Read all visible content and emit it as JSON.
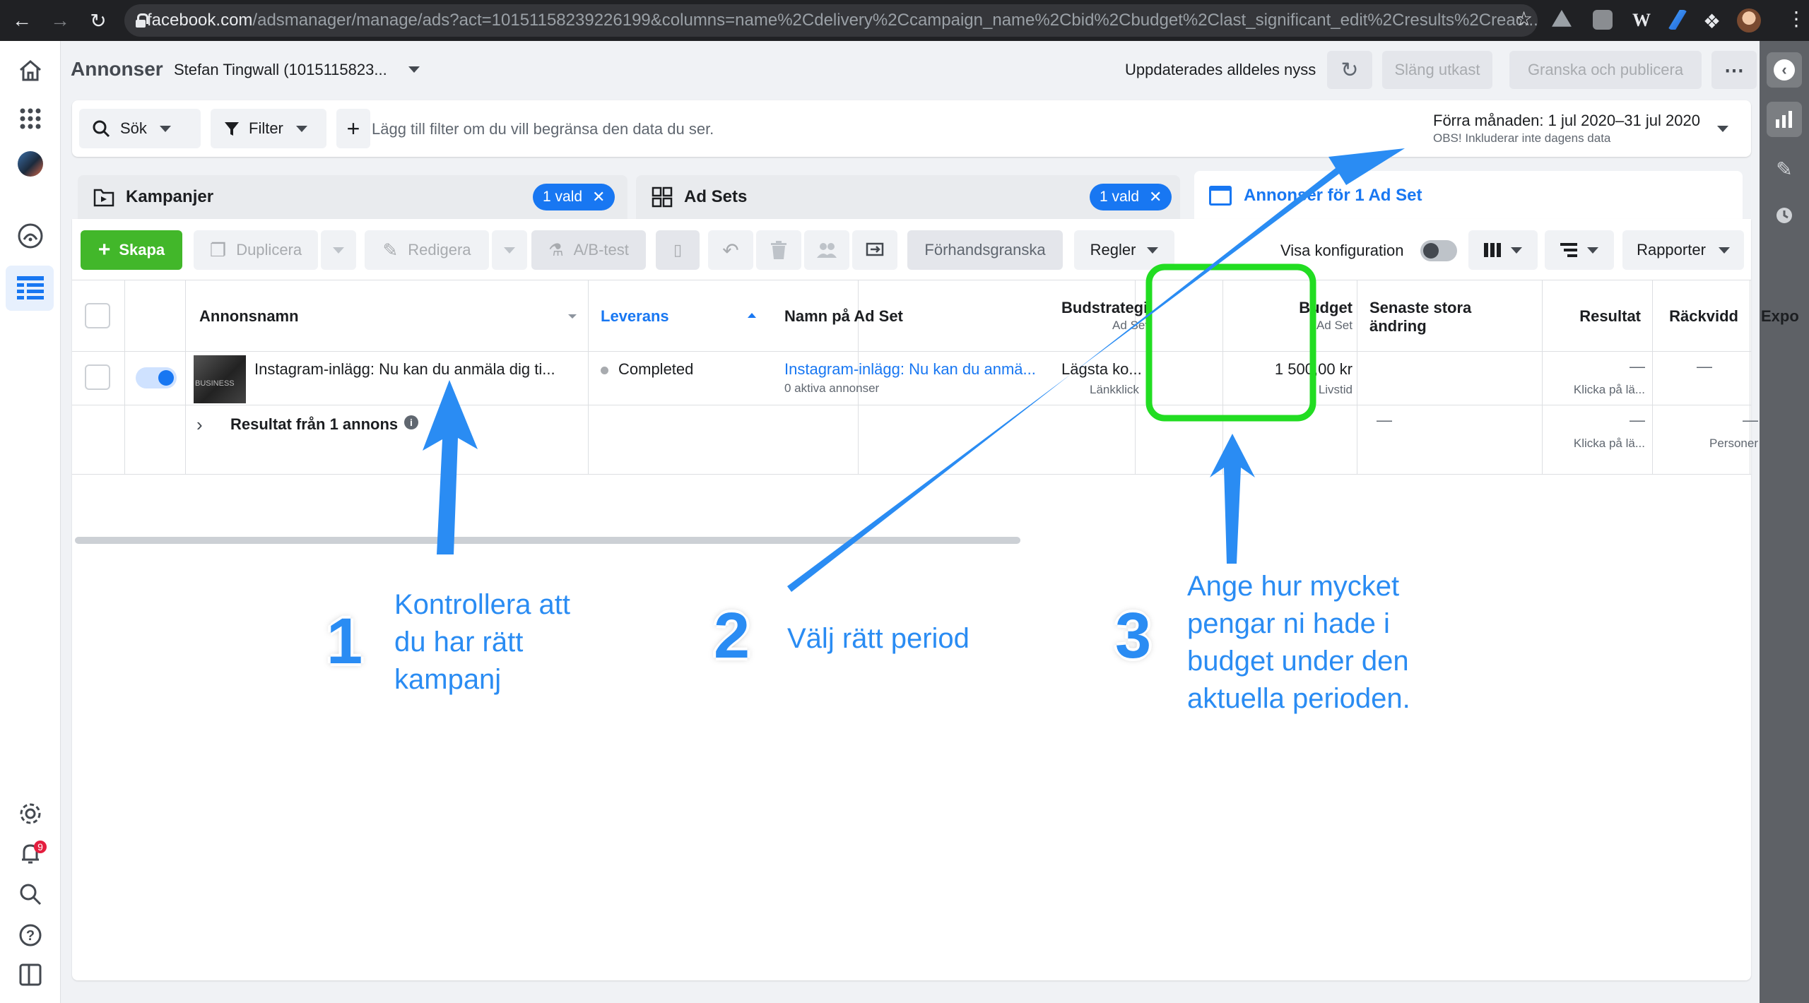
{
  "browser": {
    "url_host": "facebook.com",
    "url_path": "/adsmanager/manage/ads?act=10151158239226199&columns=name%2Cdelivery%2Ccampaign_name%2Cbid%2Cbudget%2Clast_significant_edit%2Cresults%2Creac..."
  },
  "header": {
    "title": "Annonser",
    "account": "Stefan Tingwall (1015115823...",
    "updated": "Uppdaterades alldeles nyss",
    "discard_label": "Släng utkast",
    "review_label": "Granska och publicera"
  },
  "filter": {
    "search_label": "Sök",
    "filter_label": "Filter",
    "placeholder": "Lägg till filter om du vill begränsa den data du ser.",
    "date_range": "Förra månaden: 1 jul 2020–31 jul 2020",
    "date_note": "OBS! Inkluderar inte dagens data"
  },
  "tabs": {
    "campaigns": {
      "label": "Kampanjer",
      "chip": "1 vald"
    },
    "adsets": {
      "label": "Ad Sets",
      "chip": "1 vald"
    },
    "ads": {
      "label": "Annonser för 1 Ad Set"
    }
  },
  "toolbar": {
    "create": "Skapa",
    "duplicate": "Duplicera",
    "edit": "Redigera",
    "ab_test": "A/B-test",
    "preview": "Förhandsgranska",
    "rules": "Regler",
    "show_config": "Visa konfiguration",
    "reports": "Rapporter"
  },
  "table": {
    "headers": {
      "ad_name": "Annonsnamn",
      "delivery": "Leverans",
      "adset_name": "Namn på Ad Set",
      "bid_strategy": "Budstrategi",
      "bid_strategy_sub": "Ad Set",
      "budget": "Budget",
      "budget_sub": "Ad Set",
      "last_edit_line1": "Senaste stora",
      "last_edit_line2": "ändring",
      "results": "Resultat",
      "reach": "Räckvidd",
      "exposure": "Expo"
    },
    "row": {
      "ad_name": "Instagram-inlägg: Nu kan du anmäla dig ti...",
      "delivery": "Completed",
      "adset_name": "Instagram-inlägg: Nu kan du anmä...",
      "adset_sub": "0 aktiva annonser",
      "bid": "Lägsta ko...",
      "bid_sub": "Länkklick",
      "budget": "1 500,00 kr",
      "budget_sub": "Livstid",
      "results": "—",
      "results_sub": "Klicka på lä...",
      "reach": "—"
    },
    "summary": {
      "label": "Resultat från 1 annons",
      "last_edit": "—",
      "results": "—",
      "results_sub": "Klicka på lä...",
      "reach": "—",
      "reach_sub": "Personer"
    }
  },
  "annotations": [
    {
      "number": "1",
      "lines": [
        "Kontrollera att",
        "du har rätt",
        "kampanj"
      ]
    },
    {
      "number": "2",
      "lines": [
        "Välj rätt period"
      ]
    },
    {
      "number": "3",
      "lines": [
        "Ange hur mycket",
        "pengar ni hade i",
        "budget under den",
        "aktuella perioden."
      ]
    }
  ],
  "notifications_count": "9",
  "colors": {
    "accent_blue": "#1877f2",
    "annotation_blue": "#2a8cf3",
    "highlight_green": "#22dd22",
    "create_green": "#42b72a"
  }
}
